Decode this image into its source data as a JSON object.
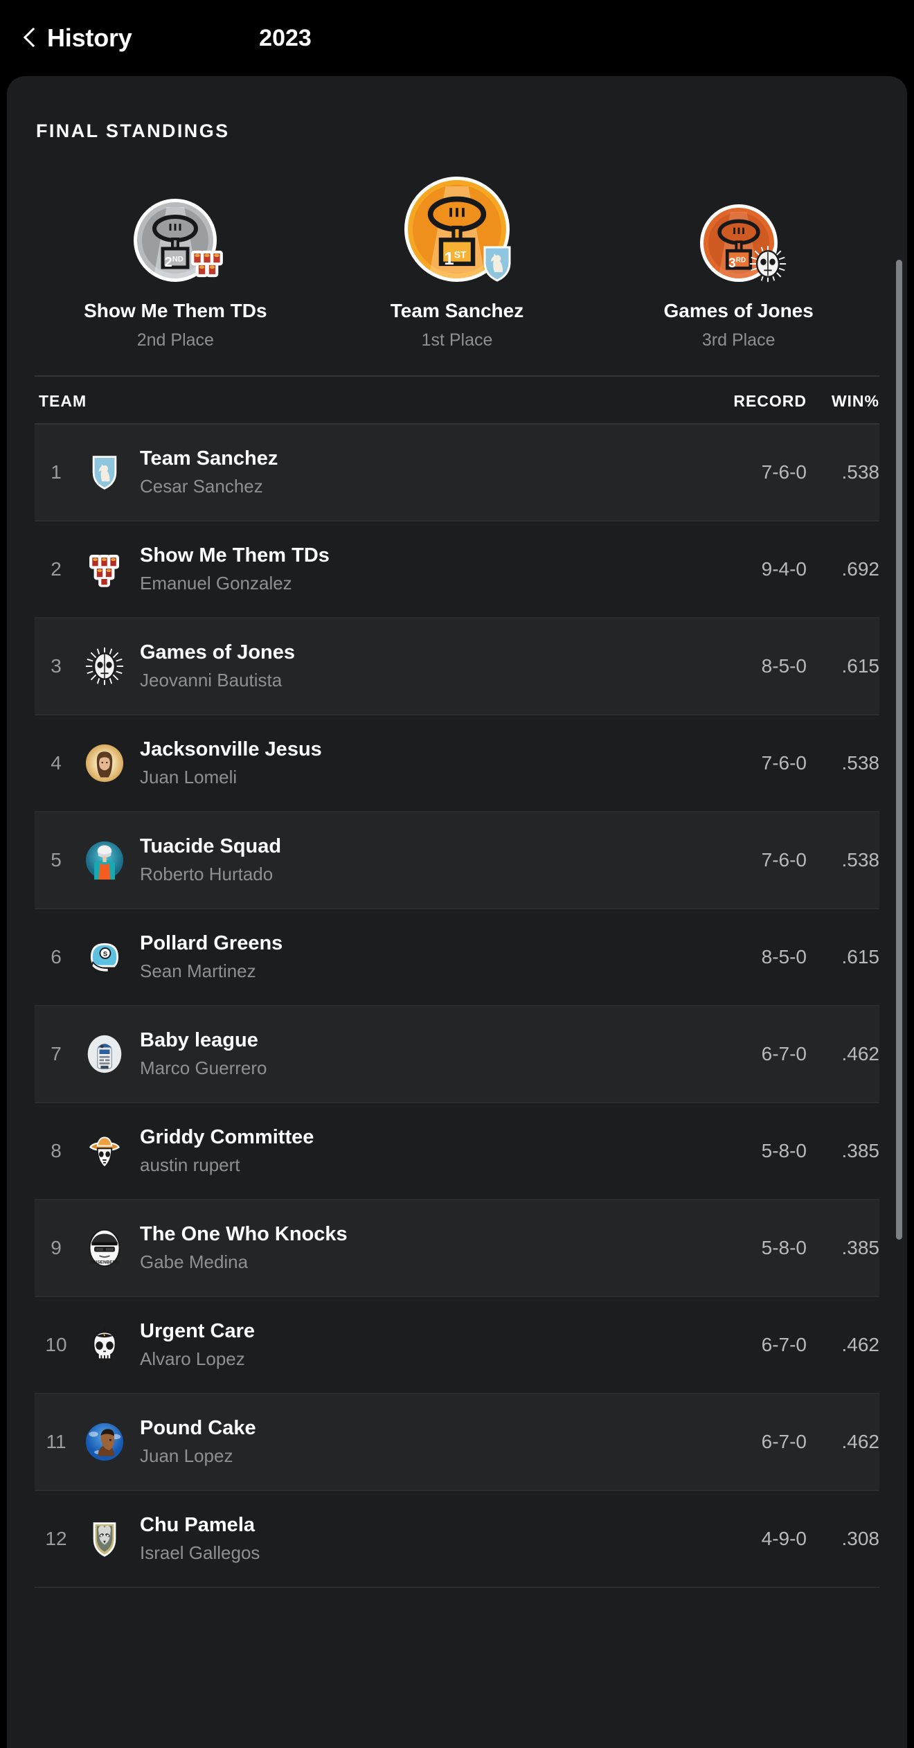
{
  "nav": {
    "back_label": "History",
    "title": "2023",
    "back_icon": "chevron-left-icon"
  },
  "section": {
    "title": "FINAL STANDINGS"
  },
  "podium": [
    {
      "team": "Show Me Them TDs",
      "place": "2nd Place",
      "medal_label": "2",
      "medal_ord": "ND",
      "medal_color": "#b8bbbd",
      "avatar_icon": "beer-pong-cups-icon"
    },
    {
      "team": "Team Sanchez",
      "place": "1st Place",
      "medal_label": "1",
      "medal_ord": "ST",
      "medal_color": "#f5a623",
      "avatar_icon": "blue-shield-knight-icon"
    },
    {
      "team": "Games of Jones",
      "place": "3rd Place",
      "medal_label": "3",
      "medal_ord": "RD",
      "medal_color": "#e0662a",
      "avatar_icon": "sun-skull-mask-icon"
    }
  ],
  "table": {
    "columns": {
      "team": "TEAM",
      "record": "RECORD",
      "win_pct": "WIN%"
    },
    "rows": [
      {
        "rank": "1",
        "team": "Team Sanchez",
        "owner": "Cesar Sanchez",
        "record": "7-6-0",
        "win_pct": ".538",
        "avatar_icon": "blue-shield-knight-icon"
      },
      {
        "rank": "2",
        "team": "Show Me Them TDs",
        "owner": "Emanuel Gonzalez",
        "record": "9-4-0",
        "win_pct": ".692",
        "avatar_icon": "beer-pong-cups-icon"
      },
      {
        "rank": "3",
        "team": "Games of Jones",
        "owner": "Jeovanni Bautista",
        "record": "8-5-0",
        "win_pct": ".615",
        "avatar_icon": "sun-skull-mask-icon"
      },
      {
        "rank": "4",
        "team": "Jacksonville Jesus",
        "owner": "Juan Lomeli",
        "record": "7-6-0",
        "win_pct": ".538",
        "avatar_icon": "jesus-portrait-icon"
      },
      {
        "rank": "5",
        "team": "Tuacide Squad",
        "owner": "Roberto Hurtado",
        "record": "7-6-0",
        "win_pct": ".538",
        "avatar_icon": "dolphins-player-icon"
      },
      {
        "rank": "6",
        "team": "Pollard Greens",
        "owner": "Sean Martinez",
        "record": "8-5-0",
        "win_pct": ".615",
        "avatar_icon": "football-helmet-icon"
      },
      {
        "rank": "7",
        "team": "Baby league",
        "owner": "Marco Guerrero",
        "record": "6-7-0",
        "win_pct": ".462",
        "avatar_icon": "r2d2-droid-icon"
      },
      {
        "rank": "8",
        "team": "Griddy Committee",
        "owner": "austin rupert",
        "record": "5-8-0",
        "win_pct": ".385",
        "avatar_icon": "cowboy-skull-icon"
      },
      {
        "rank": "9",
        "team": "The One Who Knocks",
        "owner": "Gabe Medina",
        "record": "5-8-0",
        "win_pct": ".385",
        "avatar_icon": "heisenberg-icon"
      },
      {
        "rank": "10",
        "team": "Urgent Care",
        "owner": "Alvaro Lopez",
        "record": "6-7-0",
        "win_pct": ".462",
        "avatar_icon": "skull-icon"
      },
      {
        "rank": "11",
        "team": "Pound Cake",
        "owner": "Juan Lopez",
        "record": "6-7-0",
        "win_pct": ".462",
        "avatar_icon": "drake-portrait-icon"
      },
      {
        "rank": "12",
        "team": "Chu Pamela",
        "owner": "Israel Gallegos",
        "record": "4-9-0",
        "win_pct": ".308",
        "avatar_icon": "raccoon-shield-icon"
      }
    ]
  },
  "colors": {
    "background": "#000000",
    "card": "#1c1d1f",
    "row_alt": "#232527",
    "text_primary": "#ffffff",
    "text_secondary": "#8e9093",
    "gold": "#f5a623",
    "silver": "#b8bbbd",
    "bronze": "#e0662a"
  }
}
